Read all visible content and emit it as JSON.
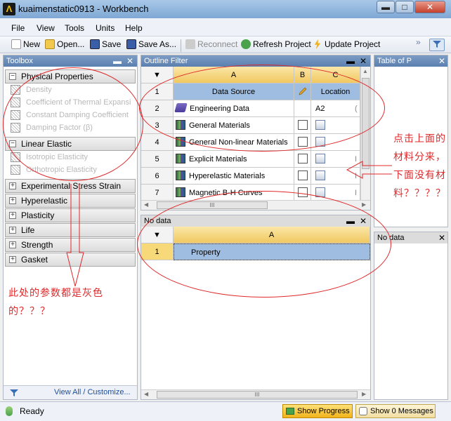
{
  "window": {
    "logo_letter": "Λ",
    "title": "kuaimenstatic0913 - Workbench",
    "min": "▬",
    "max": "□",
    "close": "✕"
  },
  "menu": [
    "File",
    "View",
    "Tools",
    "Units",
    "Help"
  ],
  "toolbar": {
    "new": "New",
    "open": "Open...",
    "save": "Save",
    "save_as": "Save As...",
    "reconnect": "Reconnect",
    "refresh": "Refresh Project",
    "update": "Update Project",
    "more": "»"
  },
  "toolbox": {
    "title": "Toolbox",
    "pin": "▬",
    "close": "✕",
    "categories": [
      {
        "label": "Physical Properties",
        "expanded": true,
        "items": [
          "Density",
          "Coefficient of Thermal Expansi",
          "Constant Damping Coefficient",
          "Damping Factor (β)"
        ]
      },
      {
        "label": "Linear Elastic",
        "expanded": true,
        "items": [
          "Isotropic Elasticity",
          "Orthotropic Elasticity"
        ]
      },
      {
        "label": "Experimental Stress Strain Data",
        "expanded": false,
        "items": []
      },
      {
        "label": "Hyperelastic",
        "expanded": false,
        "items": []
      },
      {
        "label": "Plasticity",
        "expanded": false,
        "items": []
      },
      {
        "label": "Life",
        "expanded": false,
        "items": []
      },
      {
        "label": "Strength",
        "expanded": false,
        "items": []
      },
      {
        "label": "Gasket",
        "expanded": false,
        "items": []
      }
    ],
    "expanded_marker": "−",
    "collapsed_marker": "+",
    "footer": "View All / Customize..."
  },
  "outline": {
    "title": "Outline Filter",
    "pin": "▬",
    "close": "✕",
    "columns": [
      "A",
      "B",
      "C"
    ],
    "header_row": {
      "num": "1",
      "a": "Data Source",
      "c": "Location"
    },
    "rows": [
      {
        "num": "2",
        "name": "Engineering Data",
        "location": "A2",
        "icon": "book"
      },
      {
        "num": "3",
        "name": "General Materials",
        "icon": "material"
      },
      {
        "num": "4",
        "name": "General Non-linear Materials",
        "icon": "material"
      },
      {
        "num": "5",
        "name": "Explicit Materials",
        "icon": "material"
      },
      {
        "num": "6",
        "name": "Hyperelastic Materials",
        "icon": "material"
      },
      {
        "num": "7",
        "name": "Magnetic B-H Curves",
        "icon": "material"
      }
    ],
    "row_tails": [
      "(",
      "",
      "",
      "I",
      "I",
      "I"
    ],
    "scroll_grip": "III"
  },
  "table_of": {
    "title": "Table of P",
    "close": "✕"
  },
  "properties": {
    "title": "No data",
    "pin": "▬",
    "close": "✕",
    "column": "A",
    "row_num": "1",
    "row_label": "Property",
    "scroll_grip": "III"
  },
  "nodata_right": {
    "title": "No data",
    "close": "✕"
  },
  "status": {
    "ready": "Ready",
    "show_progress": "Show Progress",
    "show_messages": "Show 0 Messages"
  },
  "annotations": {
    "right": [
      "点击上面的",
      "材料分来，",
      "下面没有材",
      "料？？？？"
    ],
    "left": [
      "此处的参数都是灰色",
      "的？？？"
    ]
  },
  "colors": {
    "annotation": "#e0282a",
    "panel_header": "#5a7fb0",
    "column_header": "#f0c860"
  }
}
